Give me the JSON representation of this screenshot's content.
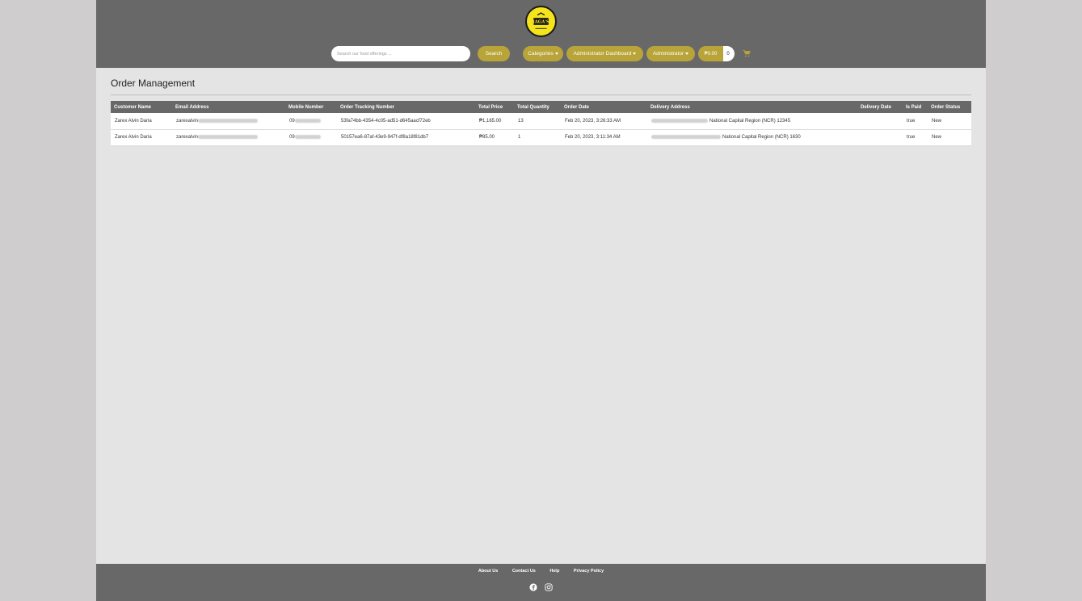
{
  "header": {
    "logo_text": "JAGA'S",
    "search": {
      "placeholder": "Search our food offerings ...",
      "value": ""
    },
    "search_label": "Search",
    "nav": [
      {
        "label": "Categories",
        "dropdown": true
      },
      {
        "label": "Administrator Dashboard",
        "dropdown": true
      },
      {
        "label": "Administrator",
        "dropdown": true
      }
    ],
    "cart": {
      "total": "₱0.00",
      "count": "0",
      "icon": "shopping-cart-icon"
    }
  },
  "main": {
    "title": "Order Management",
    "columns": [
      "Customer Name",
      "Email Address",
      "Mobile Number",
      "Order Tracking Number",
      "Total Price",
      "Total Quantity",
      "Order Date",
      "Delivery Address",
      "Delivery Date",
      "Is Paid",
      "Order Status"
    ],
    "rows": [
      {
        "customer_name": "Zarex Alvin Daria",
        "email_prefix": "zarexalvin",
        "mobile_prefix": "09",
        "tracking": "53fa74bb-4354-4c05-ad51-d645aacf72eb",
        "price": "₱1,165.00",
        "quantity": "13",
        "order_date": "Feb 20, 2023, 3:26:33 AM",
        "address_visible": "National Capital Region (NCR) 12345",
        "delivery_date": "",
        "is_paid": "true",
        "status": "New"
      },
      {
        "customer_name": "Zarex Alvin Daria",
        "email_prefix": "zarexalvin",
        "mobile_prefix": "09",
        "tracking": "50157ea6-87af-43e9-947f-df8a18f81db7",
        "price": "₱85.00",
        "quantity": "1",
        "order_date": "Feb 20, 2023, 3:11:34 AM",
        "address_visible": "National Capital Region (NCR) 1630",
        "delivery_date": "",
        "is_paid": "true",
        "status": "New"
      }
    ]
  },
  "footer": {
    "links": [
      "About Us",
      "Contact Us",
      "Help",
      "Privacy Policy"
    ],
    "social_icons": [
      "facebook-icon",
      "instagram-icon"
    ]
  },
  "colors": {
    "header_bg": "#686868",
    "accent": "#b9a43a",
    "page_bg": "#e4e4e4",
    "logo_yellow": "#f5e31b"
  }
}
